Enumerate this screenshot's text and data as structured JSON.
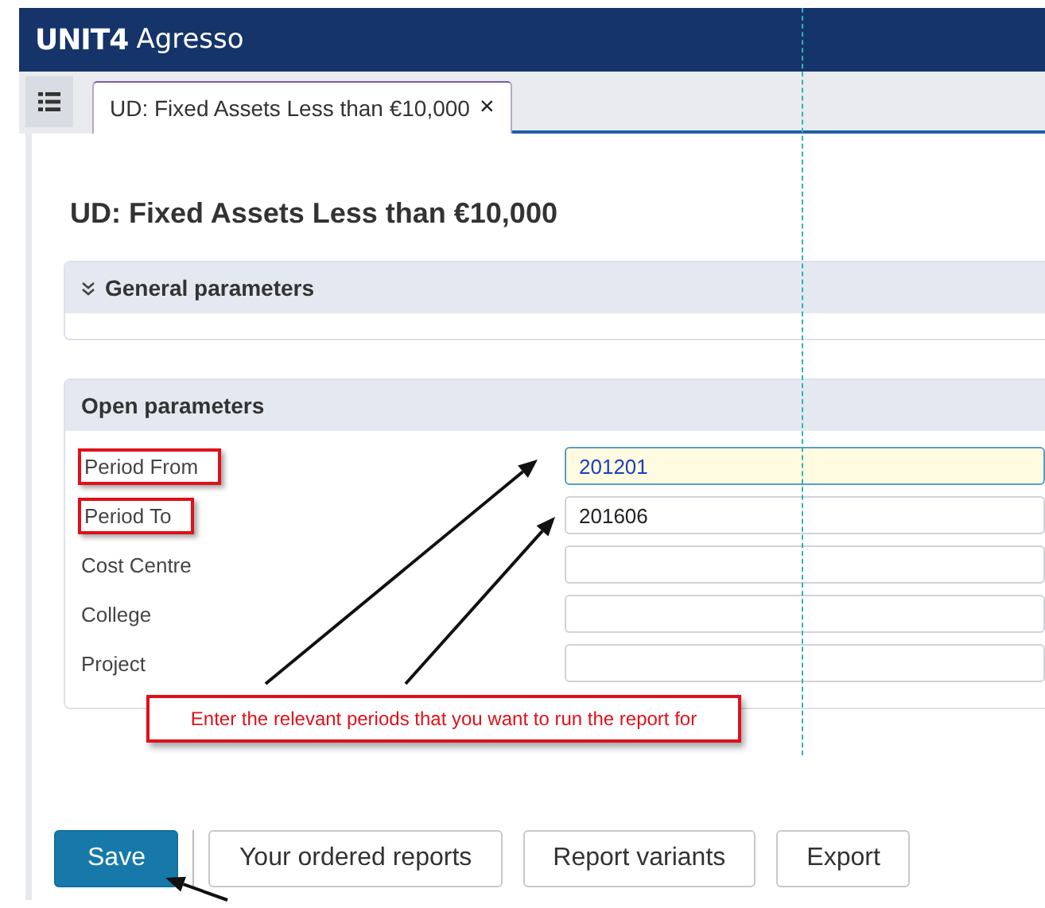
{
  "header": {
    "brand": "UNIT4",
    "product": "Agresso"
  },
  "tabs": [
    {
      "label": "UD: Fixed Assets Less than €10,000",
      "close": "×",
      "selected": true
    }
  ],
  "page_title": "UD: Fixed Assets Less than €10,000",
  "sections": [
    {
      "title": "General parameters",
      "expanded": false
    },
    {
      "title": "Open parameters",
      "expanded": true,
      "fields": [
        {
          "label": "Period From",
          "value": "201201",
          "focused": true,
          "annotated": true
        },
        {
          "label": "Period To",
          "value": "201606",
          "focused": false,
          "annotated": true
        },
        {
          "label": "Cost Centre",
          "focused": false,
          "annotated": false
        },
        {
          "label": "College",
          "focused": false,
          "annotated": false
        },
        {
          "label": "Project",
          "focused": false,
          "annotated": false
        }
      ]
    }
  ],
  "callout": "Enter the relevant periods that you want to run the report for",
  "buttons": [
    {
      "label": "Save",
      "kind": "primary"
    },
    {
      "label": "Your ordered reports",
      "kind": "secondary"
    },
    {
      "label": "Report variants",
      "kind": "secondary"
    },
    {
      "label": "Export",
      "kind": "secondary"
    }
  ]
}
